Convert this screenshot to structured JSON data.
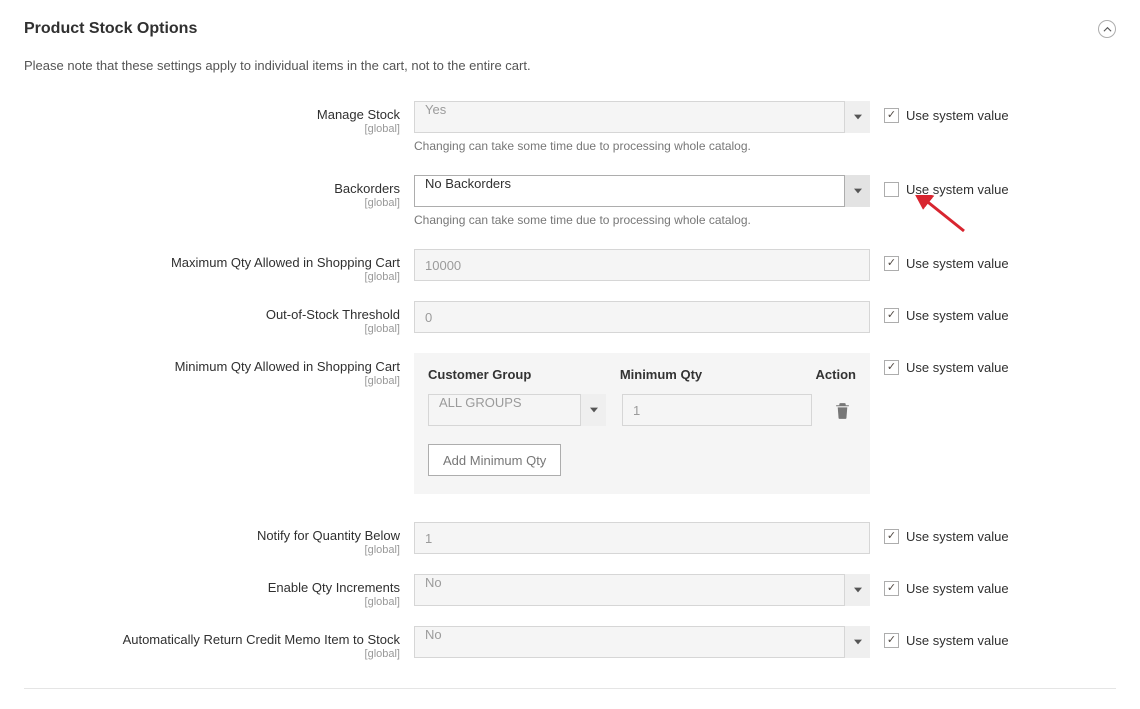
{
  "section": {
    "title": "Product Stock Options",
    "note": "Please note that these settings apply to individual items in the cart, not to the entire cart."
  },
  "labels": {
    "use_system_value": "Use system value",
    "scope_global": "[global]"
  },
  "fields": {
    "manage_stock": {
      "label": "Manage Stock",
      "value": "Yes",
      "note": "Changing can take some time due to processing whole catalog.",
      "use_system": true
    },
    "backorders": {
      "label": "Backorders",
      "value": "No Backorders",
      "note": "Changing can take some time due to processing whole catalog.",
      "use_system": false
    },
    "max_qty": {
      "label": "Maximum Qty Allowed in Shopping Cart",
      "value": "10000",
      "use_system": true
    },
    "oos_threshold": {
      "label": "Out-of-Stock Threshold",
      "value": "0",
      "use_system": true
    },
    "min_qty": {
      "label": "Minimum Qty Allowed in Shopping Cart",
      "use_system": true,
      "table": {
        "headers": {
          "group": "Customer Group",
          "min": "Minimum Qty",
          "action": "Action"
        },
        "row": {
          "group": "ALL GROUPS",
          "min": "1"
        },
        "add_button": "Add Minimum Qty"
      }
    },
    "notify_below": {
      "label": "Notify for Quantity Below",
      "value": "1",
      "use_system": true
    },
    "enable_increments": {
      "label": "Enable Qty Increments",
      "value": "No",
      "use_system": true
    },
    "auto_return": {
      "label": "Automatically Return Credit Memo Item to Stock",
      "value": "No",
      "use_system": true
    }
  }
}
